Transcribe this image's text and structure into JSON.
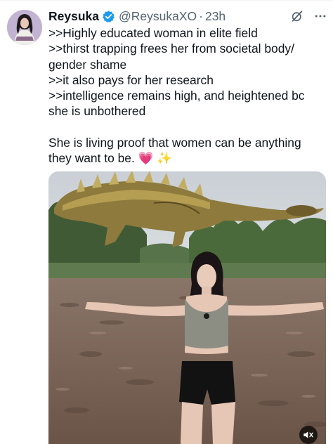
{
  "tweet": {
    "author_name": "Reysuka",
    "handle": "@ReysukaXO",
    "separator": "·",
    "time": "23h",
    "text": ">>Highly educated woman in elite field\n>>thirst trapping frees her from societal body/\ngender shame\n>>it also pays for her research\n>>intelligence remains high, and heightened bc\nshe is unbothered\n\nShe is living proof that women can be anything\nthey want to be. 💗 ✨"
  },
  "icons": {
    "verified": "verified-badge-icon",
    "grok": "grok-icon",
    "more": "more-icon",
    "mute": "speaker-muted-icon"
  },
  "colors": {
    "verified_blue": "#1d9bf0",
    "secondary_text": "#536471",
    "primary_text": "#0f1419"
  }
}
